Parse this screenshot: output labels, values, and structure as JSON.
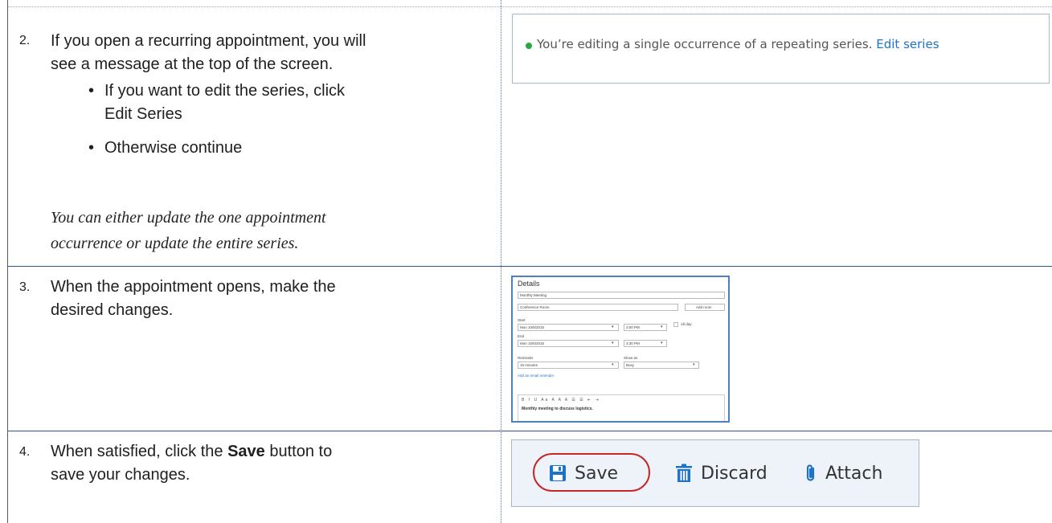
{
  "rows": [
    {
      "number": "2.",
      "text_line1": "If you open a recurring appointment, you will",
      "text_line2": "see a message at the top of the screen.",
      "bullets": [
        {
          "line1": "If you want to edit the series, click",
          "line2": "Edit Series"
        },
        {
          "line1": "Otherwise continue"
        }
      ],
      "note_line1": "You can either update the one appointment",
      "note_line2": "occurrence or update the entire series."
    },
    {
      "number": "3.",
      "text_line1": "When the appointment opens, make the",
      "text_line2": "desired changes."
    },
    {
      "number": "4.",
      "text_line1_before": "When satisfied, click the ",
      "text_bold": "Save",
      "text_line1_after": " button to",
      "text_line2": "save your changes."
    }
  ],
  "banner": {
    "message": "You’re editing a single occurrence of a repeating series.",
    "link": "Edit series",
    "status_color": "#28a745"
  },
  "form": {
    "title": "Details",
    "subject": "Monthly Meeting",
    "location": "Conference Room",
    "add_room": "Add room",
    "start_label": "Start",
    "start_date": "Mon 10/5/2015",
    "start_time": "3:00 PM",
    "all_day": "All day",
    "end_label": "End",
    "end_date": "Mon 10/5/2015",
    "end_time": "3:30 PM",
    "reminder_label": "Reminder",
    "reminder": "15 minutes",
    "show_as_label": "Show as",
    "show_as": "Busy",
    "email_reminder": "Add an email reminder",
    "editor_toolbar": "B I U Aa A A A ☰ ☰ ⇤ ⇥",
    "body": "Monthly meeting to discuss logistics."
  },
  "toolbar": {
    "save": "Save",
    "discard": "Discard",
    "attach": "Attach",
    "accent": "#1e73c8",
    "highlight": "#c42828"
  }
}
